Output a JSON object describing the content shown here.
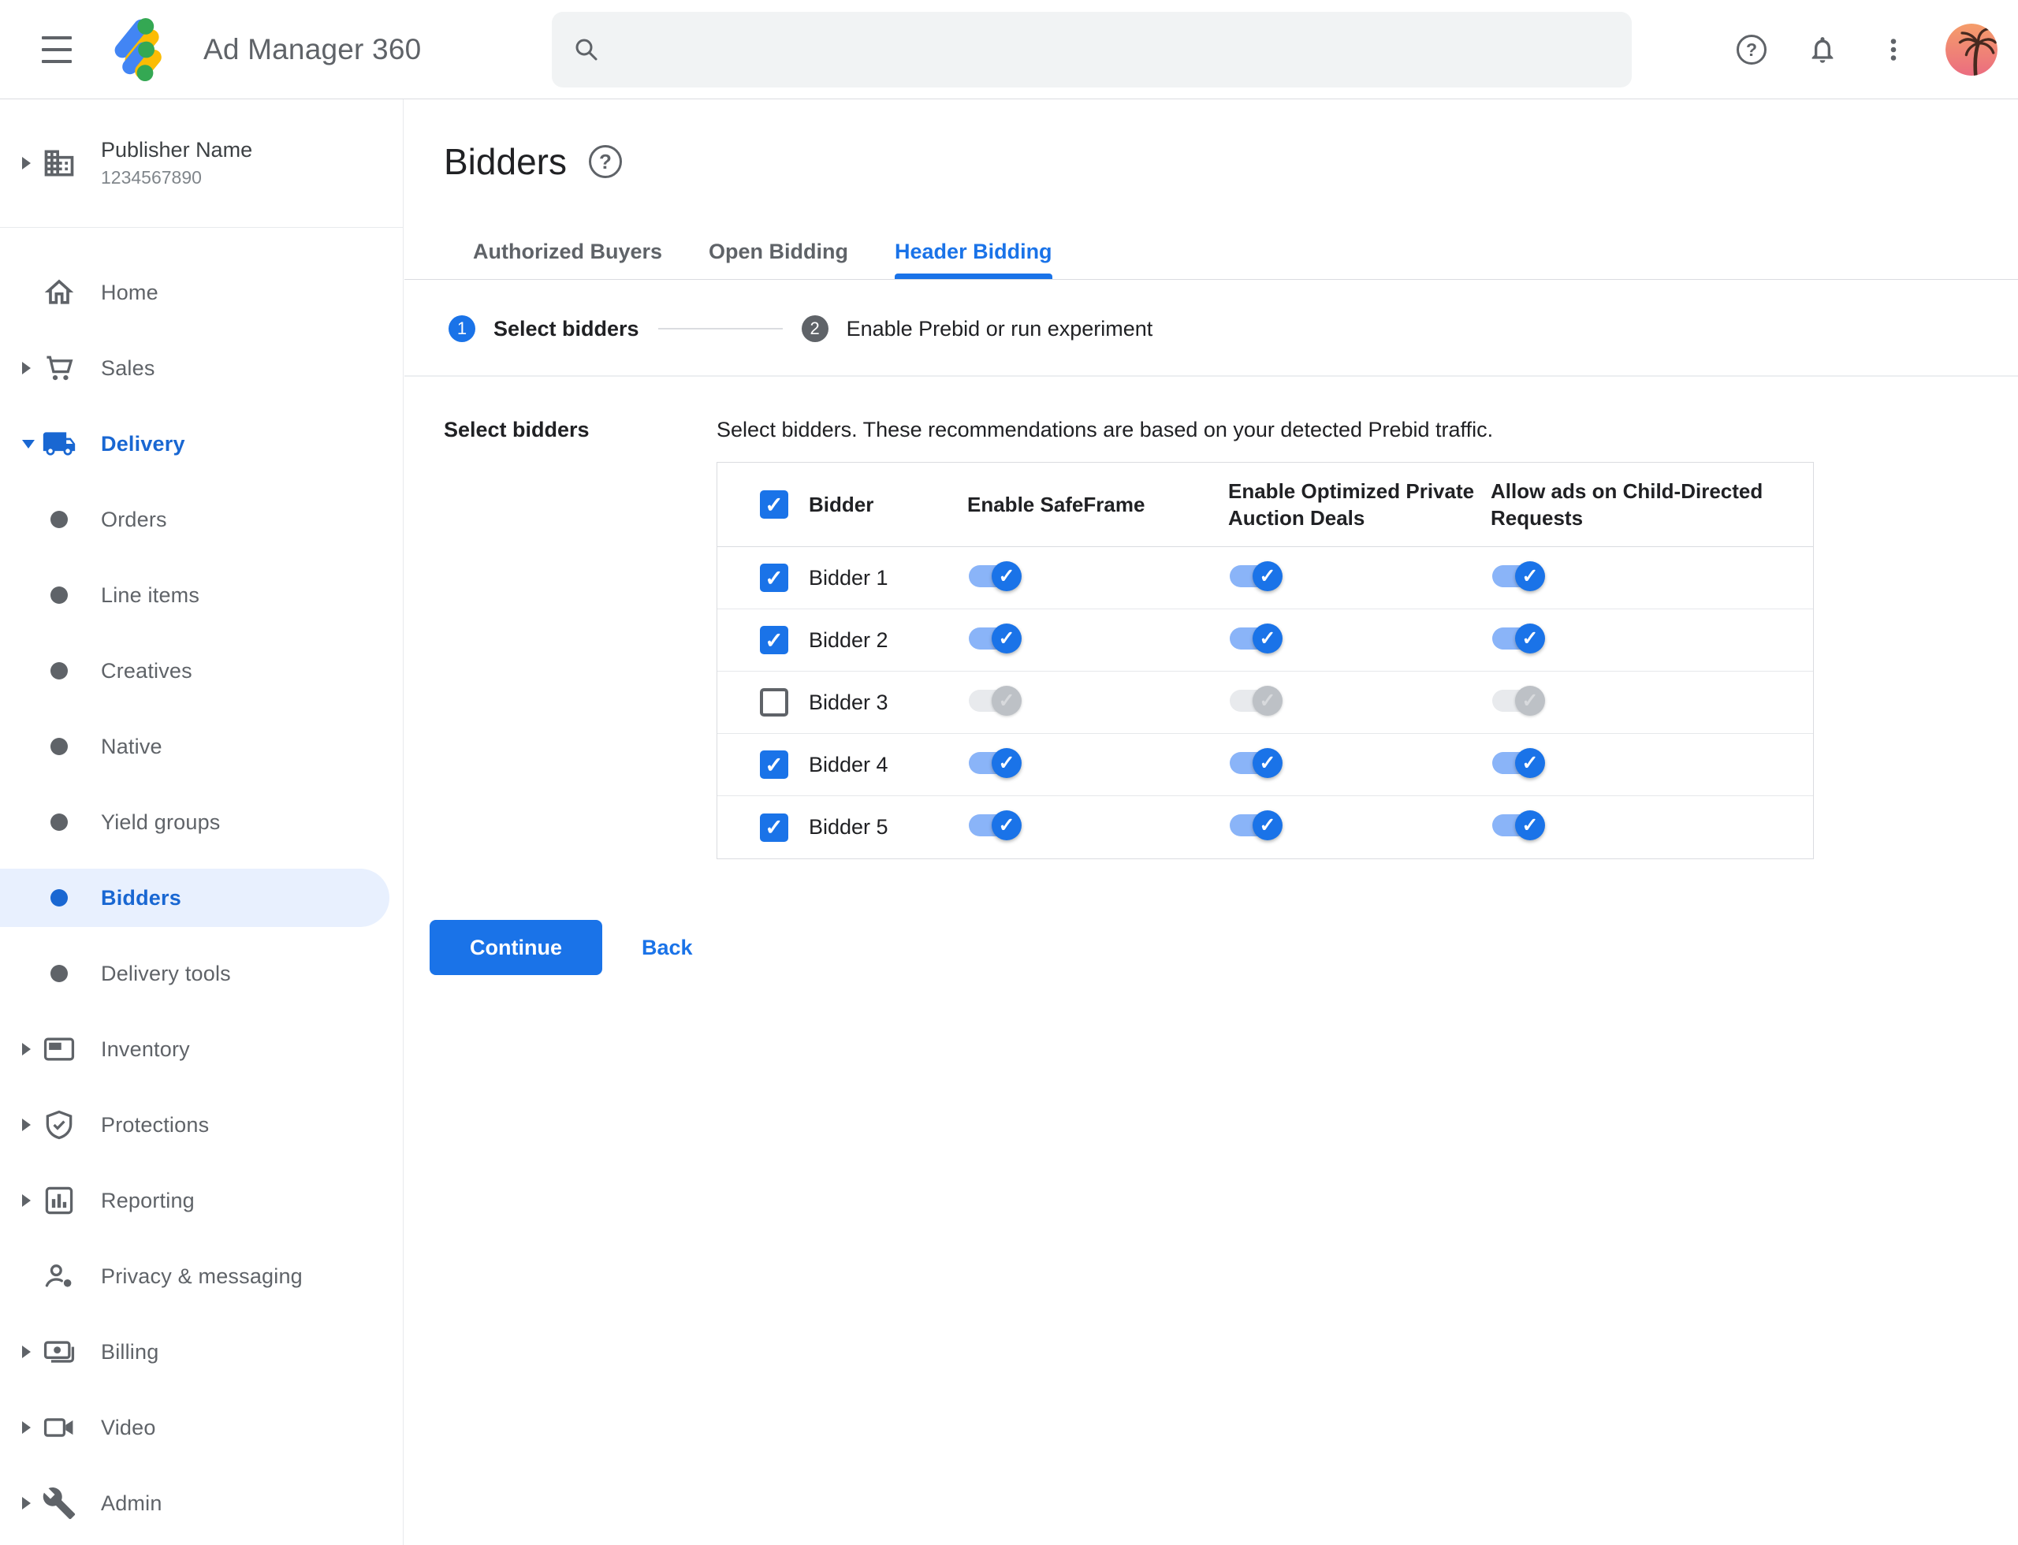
{
  "topbar": {
    "app_name": "Ad Manager 360",
    "search": {
      "value": "",
      "placeholder": ""
    }
  },
  "sidebar": {
    "publisher": {
      "name": "Publisher Name",
      "id": "1234567890"
    },
    "items": [
      {
        "label": "Home"
      },
      {
        "label": "Sales"
      },
      {
        "label": "Delivery"
      },
      {
        "label": "Orders"
      },
      {
        "label": "Line items"
      },
      {
        "label": "Creatives"
      },
      {
        "label": "Native"
      },
      {
        "label": "Yield groups"
      },
      {
        "label": "Bidders"
      },
      {
        "label": "Delivery tools"
      },
      {
        "label": "Inventory"
      },
      {
        "label": "Protections"
      },
      {
        "label": "Reporting"
      },
      {
        "label": "Privacy & messaging"
      },
      {
        "label": "Billing"
      },
      {
        "label": "Video"
      },
      {
        "label": "Admin"
      }
    ]
  },
  "page": {
    "title": "Bidders",
    "tabs": [
      {
        "label": "Authorized Buyers",
        "active": false
      },
      {
        "label": "Open Bidding",
        "active": false
      },
      {
        "label": "Header Bidding",
        "active": true
      }
    ],
    "stepper": [
      {
        "number": "1",
        "label": "Select bidders"
      },
      {
        "number": "2",
        "label": "Enable Prebid or run experiment"
      }
    ]
  },
  "content": {
    "section_label": "Select bidders",
    "description": "Select bidders. These recommendations are based on your detected Prebid traffic.",
    "table": {
      "header_checkbox": "checked",
      "headers": [
        "Bidder",
        "Enable SafeFrame",
        "Enable Optimized Private Auction Deals",
        "Allow ads on Child-Directed Requests"
      ],
      "rows": [
        {
          "name": "Bidder 1",
          "checkbox": "checked",
          "safeframe": "on",
          "optimized": "on",
          "child_directed": "on"
        },
        {
          "name": "Bidder 2",
          "checkbox": "checked",
          "safeframe": "on",
          "optimized": "on",
          "child_directed": "on"
        },
        {
          "name": "Bidder 3",
          "checkbox": "unchecked",
          "safeframe": "off",
          "optimized": "off",
          "child_directed": "off"
        },
        {
          "name": "Bidder 4",
          "checkbox": "checked",
          "safeframe": "on",
          "optimized": "on",
          "child_directed": "on"
        },
        {
          "name": "Bidder 5",
          "checkbox": "checked",
          "safeframe": "on",
          "optimized": "on",
          "child_directed": "on"
        }
      ]
    },
    "actions": {
      "continue_label": "Continue",
      "back_label": "Back"
    }
  },
  "colors": {
    "accent_blue": "#1a73e8",
    "sidebar_active_blue": "#1967d2",
    "sidebar_active_bg": "#e8f0fe",
    "toggle_track_on": "#8ab4f8",
    "toggle_thumb_off": "#bdc1c6",
    "text_primary": "#202124",
    "text_secondary": "#5f6368",
    "border": "#dadce0",
    "search_bg": "#f1f3f4"
  }
}
